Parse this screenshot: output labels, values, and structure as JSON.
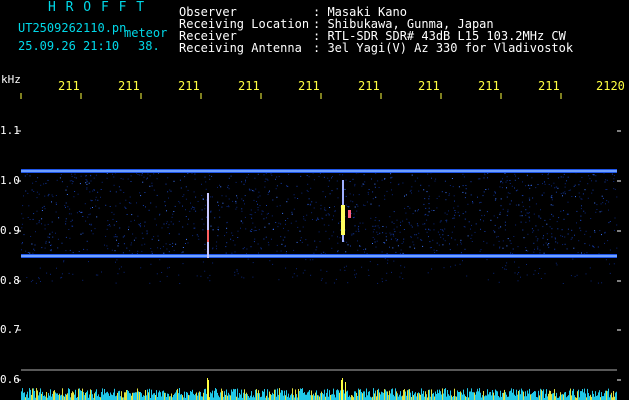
{
  "header": {
    "logo": "H R O F F T",
    "filename": "UT2509262110.pn",
    "category": "meteor",
    "datetime": "25.09.26 21:10",
    "count": "38.",
    "info_labels": [
      "Observer",
      "Receiving Location",
      "Receiver",
      "Receiving Antenna"
    ],
    "info_values": [
      ": Masaki Kano",
      ": Shibukawa, Gunma, Japan",
      ": RTL-SDR SDR# 43dB L15 103.2MHz CW",
      ": 3el Yagi(V) Az 330 for Vladivostok"
    ]
  },
  "time_axis": {
    "ticks": [
      "211",
      "211",
      "211",
      "211",
      "211",
      "211",
      "211",
      "211",
      "211",
      "2120"
    ]
  },
  "freq_axis": {
    "unit": "kHz",
    "ticks": [
      "1.1",
      "1.0",
      "0.9",
      "0.8",
      "0.7",
      "0.6"
    ]
  },
  "colors": {
    "text_cyan": "#00d8e8",
    "text_yellow": "#ffff40",
    "signal_line": "#2060ff",
    "noise": "#0a2a8a",
    "meteor": "#ffffff"
  }
}
